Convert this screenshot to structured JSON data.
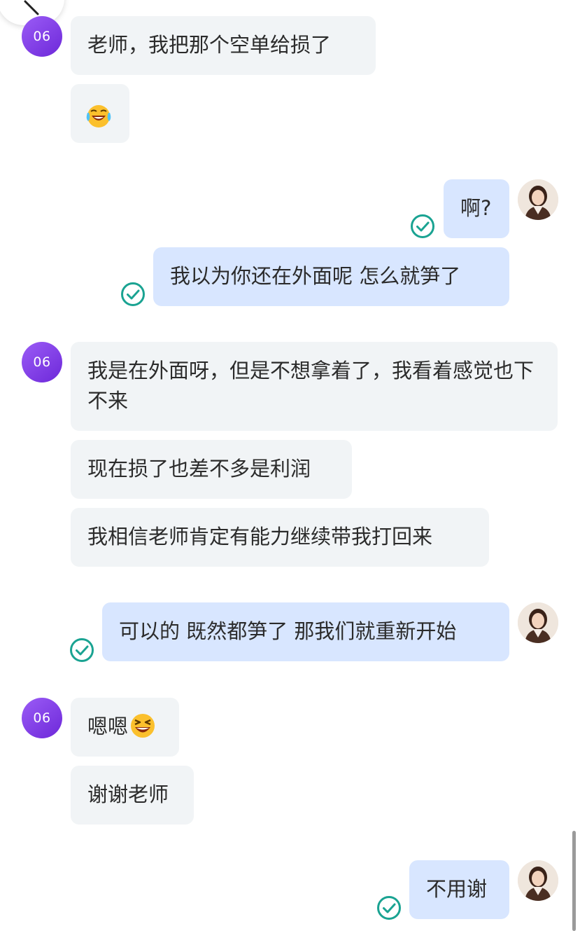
{
  "navigation": {
    "back_icon": "chevron-left-icon"
  },
  "contact": {
    "avatar_label": "06",
    "avatar_color": "#7c3aed"
  },
  "messages": [
    {
      "from": "contact",
      "text": "老师，我把那个空单给损了"
    },
    {
      "from": "contact",
      "text": "",
      "emoji": "crying-laughing-emoji"
    },
    {
      "from": "self",
      "text": "啊?",
      "read": true
    },
    {
      "from": "self",
      "text": "我以为你还在外面呢 怎么就笋了",
      "read": true
    },
    {
      "from": "contact",
      "text": "我是在外面呀，但是不想拿着了，我看着感觉也下不来"
    },
    {
      "from": "contact",
      "text": "现在损了也差不多是利润"
    },
    {
      "from": "contact",
      "text": "我相信老师肯定有能力继续带我打回来"
    },
    {
      "from": "self",
      "text": "可以的 既然都笋了 那我们就重新开始",
      "read": true
    },
    {
      "from": "contact",
      "text": "嗯嗯",
      "emoji": "grinning-squinting-emoji"
    },
    {
      "from": "contact",
      "text": "谢谢老师"
    },
    {
      "from": "self",
      "text": "不用谢",
      "read": true
    }
  ],
  "colors": {
    "incoming_bubble": "#f1f4f6",
    "outgoing_bubble": "#d8e6ff",
    "read_check": "#1aa392",
    "text": "#2b2b2b"
  }
}
